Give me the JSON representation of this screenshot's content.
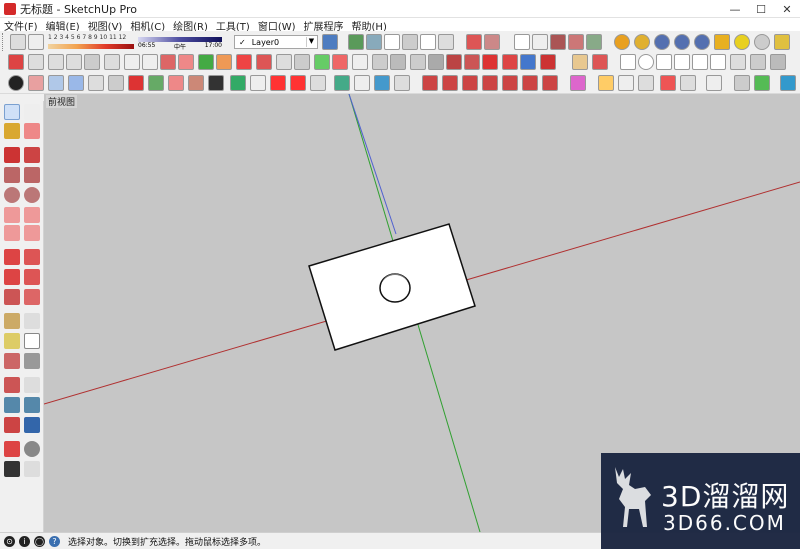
{
  "window": {
    "title": "无标题 - SketchUp Pro",
    "min": "—",
    "max": "☐",
    "close": "✕"
  },
  "menu": [
    "文件(F)",
    "编辑(E)",
    "视图(V)",
    "相机(C)",
    "绘图(R)",
    "工具(T)",
    "窗口(W)",
    "扩展程序",
    "帮助(H)"
  ],
  "shadow": {
    "months": "1 2 3 4 5 6 7 8 9 10 11 12",
    "time_start": "06:55",
    "time_mid": "中午",
    "time_end": "17:00"
  },
  "layer": {
    "name": "Layer0",
    "check": "✓"
  },
  "viewport": {
    "label": "前视图"
  },
  "status": {
    "text": "选择对象。切换到扩充选择。拖动鼠标选择多项。"
  },
  "brand": {
    "name": "3D溜溜网",
    "site": "3D66.COM"
  },
  "colors": {
    "green_axis": "#30a030",
    "red_axis": "#b03030",
    "blue_axis": "#3040c0",
    "bg": "#c6c6c6"
  }
}
